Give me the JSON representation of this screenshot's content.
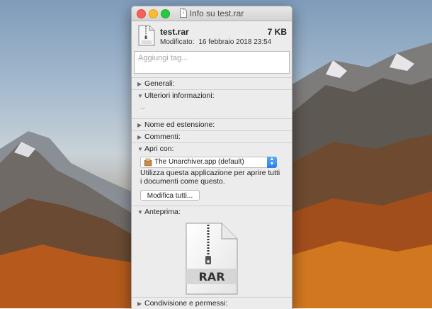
{
  "window": {
    "title": "Info su test.rar",
    "title_icon": "rar-document-icon"
  },
  "file": {
    "name": "test.rar",
    "size": "7 KB",
    "modified_label": "Modificato:",
    "modified_value": "16 febbraio 2018 23:54",
    "icon": "rar-archive-icon"
  },
  "tags": {
    "placeholder": "Aggiungi tag..."
  },
  "sections": {
    "generali": "Generali:",
    "ulteriori": "Ulteriori informazioni:",
    "ulteriori_value": "--",
    "nome": "Nome ed estensione:",
    "commenti": "Commenti:",
    "apri": "Apri con:",
    "anteprima": "Anteprima:",
    "condivisione": "Condivisione e permessi:"
  },
  "open_with": {
    "selected_app": "The Unarchiver.app (default)",
    "app_icon": "unarchiver-app-icon",
    "description": "Utilizza questa applicazione per aprire tutti i documenti come questo.",
    "change_all_label": "Modifica tutti..."
  },
  "preview": {
    "label": "RAR"
  },
  "colors": {
    "close": "#fc5f57",
    "minimize": "#fdbc2e",
    "maximize": "#28c840",
    "popup_accent": "#2a7ff0"
  }
}
